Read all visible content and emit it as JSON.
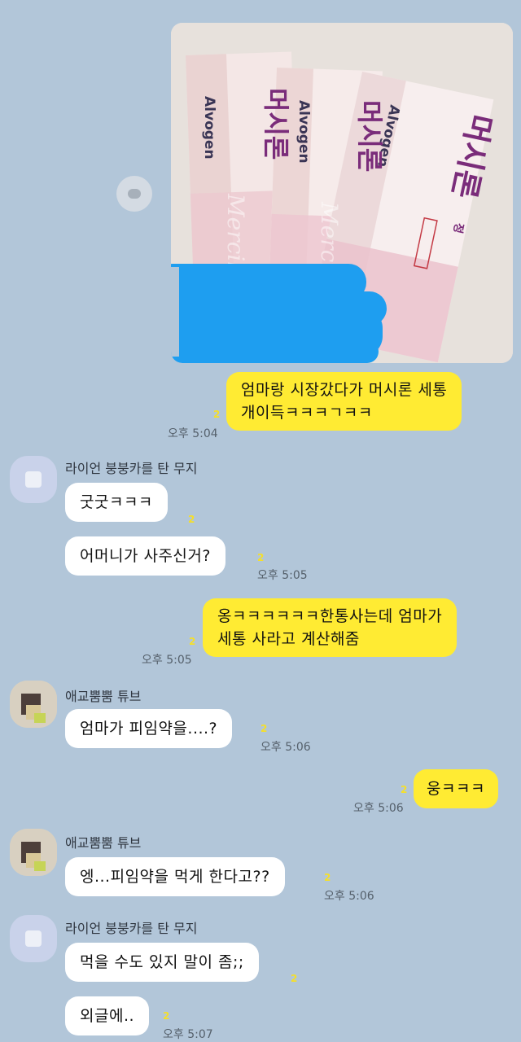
{
  "photo": {
    "box_brand": "Alvogen",
    "box_name": "머시론",
    "box_suffix": "정",
    "box_script": "Mercilon"
  },
  "messages": [
    {
      "text_lines": [
        "엄마랑 시장갔다가 머시론 세통",
        "개이득ㅋㅋㅋㄱㅋㅋ"
      ],
      "time": "오후 5:04",
      "unread": "2"
    },
    {
      "sender": "라이언 붕붕카를 탄 무지"
    },
    {
      "text": "굿굿ㅋㅋㅋ",
      "unread": "2"
    },
    {
      "text": "어머니가 사주신거?",
      "unread": "2",
      "time": "오후 5:05"
    },
    {
      "text_lines": [
        "옹ㅋㅋㅋㅋㅋㅋ한통사는데 엄마가",
        "세통 사라고 계산해줌"
      ],
      "time": "오후 5:05",
      "unread": "2"
    },
    {
      "sender": "애교뿜뿜 튜브"
    },
    {
      "text": "엄마가 피임약을....?",
      "unread": "2",
      "time": "오후 5:06"
    },
    {
      "text": "웅ㅋㅋㅋ",
      "unread": "2",
      "time": "오후 5:06"
    },
    {
      "sender": "애교뿜뿜 튜브"
    },
    {
      "text": "엥...피임약을 먹게 한다고??",
      "unread": "2",
      "time": "오후 5:06"
    },
    {
      "sender": "라이언 붕붕카를 탄 무지"
    },
    {
      "text": "먹을 수도 있지 말이 좀;;",
      "unread": "2"
    },
    {
      "text": "외글에..",
      "unread": "2",
      "time": "오후 5:07"
    }
  ]
}
